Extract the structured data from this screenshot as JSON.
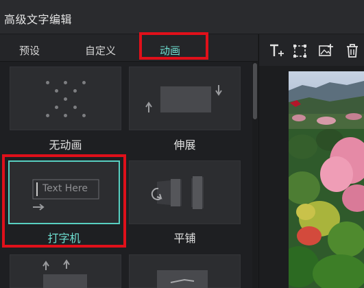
{
  "window": {
    "title": "高级文字编辑"
  },
  "tabs": [
    {
      "label": "预设"
    },
    {
      "label": "自定义"
    },
    {
      "label": "动画",
      "active": true
    }
  ],
  "animations": [
    {
      "label": "无动画"
    },
    {
      "label": "伸展"
    },
    {
      "label": "打字机",
      "selected": true,
      "sample_text": "Text Here"
    },
    {
      "label": "平铺"
    }
  ],
  "toolbar": {
    "icons": [
      "add-text-icon",
      "crop-select-icon",
      "add-image-icon",
      "delete-icon"
    ]
  },
  "colors": {
    "accent": "#6fe0d2",
    "highlight": "#e0101a",
    "panel": "#1e1f22",
    "card": "#2c2d30"
  }
}
